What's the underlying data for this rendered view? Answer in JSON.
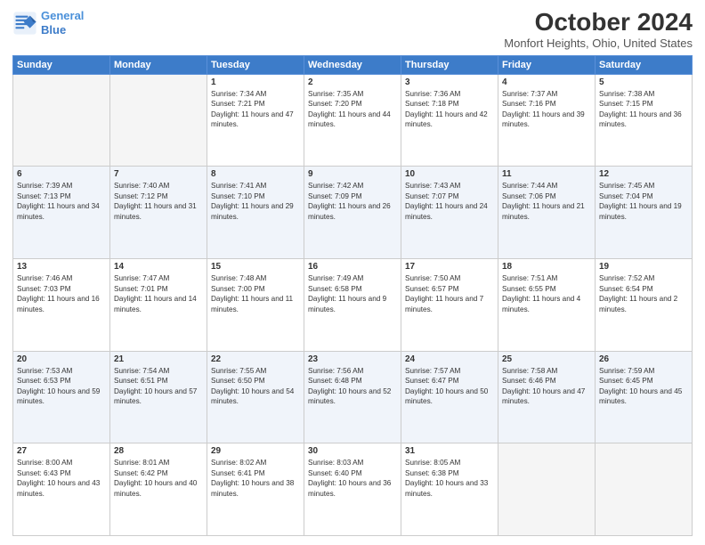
{
  "header": {
    "logo_line1": "General",
    "logo_line2": "Blue",
    "title": "October 2024",
    "subtitle": "Monfort Heights, Ohio, United States"
  },
  "days_of_week": [
    "Sunday",
    "Monday",
    "Tuesday",
    "Wednesday",
    "Thursday",
    "Friday",
    "Saturday"
  ],
  "weeks": [
    [
      {
        "day": "",
        "sunrise": "",
        "sunset": "",
        "daylight": "",
        "empty": true
      },
      {
        "day": "",
        "sunrise": "",
        "sunset": "",
        "daylight": "",
        "empty": true
      },
      {
        "day": "1",
        "sunrise": "Sunrise: 7:34 AM",
        "sunset": "Sunset: 7:21 PM",
        "daylight": "Daylight: 11 hours and 47 minutes."
      },
      {
        "day": "2",
        "sunrise": "Sunrise: 7:35 AM",
        "sunset": "Sunset: 7:20 PM",
        "daylight": "Daylight: 11 hours and 44 minutes."
      },
      {
        "day": "3",
        "sunrise": "Sunrise: 7:36 AM",
        "sunset": "Sunset: 7:18 PM",
        "daylight": "Daylight: 11 hours and 42 minutes."
      },
      {
        "day": "4",
        "sunrise": "Sunrise: 7:37 AM",
        "sunset": "Sunset: 7:16 PM",
        "daylight": "Daylight: 11 hours and 39 minutes."
      },
      {
        "day": "5",
        "sunrise": "Sunrise: 7:38 AM",
        "sunset": "Sunset: 7:15 PM",
        "daylight": "Daylight: 11 hours and 36 minutes."
      }
    ],
    [
      {
        "day": "6",
        "sunrise": "Sunrise: 7:39 AM",
        "sunset": "Sunset: 7:13 PM",
        "daylight": "Daylight: 11 hours and 34 minutes."
      },
      {
        "day": "7",
        "sunrise": "Sunrise: 7:40 AM",
        "sunset": "Sunset: 7:12 PM",
        "daylight": "Daylight: 11 hours and 31 minutes."
      },
      {
        "day": "8",
        "sunrise": "Sunrise: 7:41 AM",
        "sunset": "Sunset: 7:10 PM",
        "daylight": "Daylight: 11 hours and 29 minutes."
      },
      {
        "day": "9",
        "sunrise": "Sunrise: 7:42 AM",
        "sunset": "Sunset: 7:09 PM",
        "daylight": "Daylight: 11 hours and 26 minutes."
      },
      {
        "day": "10",
        "sunrise": "Sunrise: 7:43 AM",
        "sunset": "Sunset: 7:07 PM",
        "daylight": "Daylight: 11 hours and 24 minutes."
      },
      {
        "day": "11",
        "sunrise": "Sunrise: 7:44 AM",
        "sunset": "Sunset: 7:06 PM",
        "daylight": "Daylight: 11 hours and 21 minutes."
      },
      {
        "day": "12",
        "sunrise": "Sunrise: 7:45 AM",
        "sunset": "Sunset: 7:04 PM",
        "daylight": "Daylight: 11 hours and 19 minutes."
      }
    ],
    [
      {
        "day": "13",
        "sunrise": "Sunrise: 7:46 AM",
        "sunset": "Sunset: 7:03 PM",
        "daylight": "Daylight: 11 hours and 16 minutes."
      },
      {
        "day": "14",
        "sunrise": "Sunrise: 7:47 AM",
        "sunset": "Sunset: 7:01 PM",
        "daylight": "Daylight: 11 hours and 14 minutes."
      },
      {
        "day": "15",
        "sunrise": "Sunrise: 7:48 AM",
        "sunset": "Sunset: 7:00 PM",
        "daylight": "Daylight: 11 hours and 11 minutes."
      },
      {
        "day": "16",
        "sunrise": "Sunrise: 7:49 AM",
        "sunset": "Sunset: 6:58 PM",
        "daylight": "Daylight: 11 hours and 9 minutes."
      },
      {
        "day": "17",
        "sunrise": "Sunrise: 7:50 AM",
        "sunset": "Sunset: 6:57 PM",
        "daylight": "Daylight: 11 hours and 7 minutes."
      },
      {
        "day": "18",
        "sunrise": "Sunrise: 7:51 AM",
        "sunset": "Sunset: 6:55 PM",
        "daylight": "Daylight: 11 hours and 4 minutes."
      },
      {
        "day": "19",
        "sunrise": "Sunrise: 7:52 AM",
        "sunset": "Sunset: 6:54 PM",
        "daylight": "Daylight: 11 hours and 2 minutes."
      }
    ],
    [
      {
        "day": "20",
        "sunrise": "Sunrise: 7:53 AM",
        "sunset": "Sunset: 6:53 PM",
        "daylight": "Daylight: 10 hours and 59 minutes."
      },
      {
        "day": "21",
        "sunrise": "Sunrise: 7:54 AM",
        "sunset": "Sunset: 6:51 PM",
        "daylight": "Daylight: 10 hours and 57 minutes."
      },
      {
        "day": "22",
        "sunrise": "Sunrise: 7:55 AM",
        "sunset": "Sunset: 6:50 PM",
        "daylight": "Daylight: 10 hours and 54 minutes."
      },
      {
        "day": "23",
        "sunrise": "Sunrise: 7:56 AM",
        "sunset": "Sunset: 6:48 PM",
        "daylight": "Daylight: 10 hours and 52 minutes."
      },
      {
        "day": "24",
        "sunrise": "Sunrise: 7:57 AM",
        "sunset": "Sunset: 6:47 PM",
        "daylight": "Daylight: 10 hours and 50 minutes."
      },
      {
        "day": "25",
        "sunrise": "Sunrise: 7:58 AM",
        "sunset": "Sunset: 6:46 PM",
        "daylight": "Daylight: 10 hours and 47 minutes."
      },
      {
        "day": "26",
        "sunrise": "Sunrise: 7:59 AM",
        "sunset": "Sunset: 6:45 PM",
        "daylight": "Daylight: 10 hours and 45 minutes."
      }
    ],
    [
      {
        "day": "27",
        "sunrise": "Sunrise: 8:00 AM",
        "sunset": "Sunset: 6:43 PM",
        "daylight": "Daylight: 10 hours and 43 minutes."
      },
      {
        "day": "28",
        "sunrise": "Sunrise: 8:01 AM",
        "sunset": "Sunset: 6:42 PM",
        "daylight": "Daylight: 10 hours and 40 minutes."
      },
      {
        "day": "29",
        "sunrise": "Sunrise: 8:02 AM",
        "sunset": "Sunset: 6:41 PM",
        "daylight": "Daylight: 10 hours and 38 minutes."
      },
      {
        "day": "30",
        "sunrise": "Sunrise: 8:03 AM",
        "sunset": "Sunset: 6:40 PM",
        "daylight": "Daylight: 10 hours and 36 minutes."
      },
      {
        "day": "31",
        "sunrise": "Sunrise: 8:05 AM",
        "sunset": "Sunset: 6:38 PM",
        "daylight": "Daylight: 10 hours and 33 minutes."
      },
      {
        "day": "",
        "sunrise": "",
        "sunset": "",
        "daylight": "",
        "empty": true
      },
      {
        "day": "",
        "sunrise": "",
        "sunset": "",
        "daylight": "",
        "empty": true
      }
    ]
  ]
}
